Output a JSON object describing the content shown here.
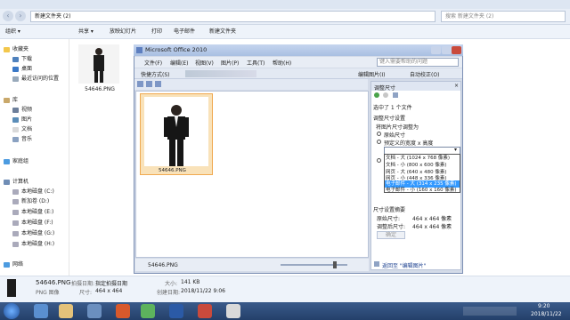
{
  "explorer": {
    "title": "新建文件夹 (2)",
    "address": "新建文件夹 (2)",
    "search_placeholder": "搜索 新建文件夹 (2)",
    "toolbar": [
      "组织 ▾",
      "共享 ▾",
      "放映幻灯片",
      "打印",
      "电子邮件",
      "新建文件夹"
    ],
    "nav": {
      "favorites_header": "收藏夹",
      "favorites": [
        "下载",
        "桌面",
        "最近访问的位置"
      ],
      "libraries_header": "库",
      "libraries": [
        "视频",
        "图片",
        "文档",
        "音乐"
      ],
      "homegroup": "家庭组",
      "computer_header": "计算机",
      "drives": [
        "本地磁盘 (C:)",
        "新加卷 (D:)",
        "本地磁盘 (E:)",
        "本地磁盘 (F:)",
        "本地磁盘 (G:)",
        "本地磁盘 (H:)"
      ],
      "network": "网络"
    },
    "file": {
      "name": "54646.PNG"
    },
    "details": {
      "filename": "54646.PNG",
      "type": "PNG 图像",
      "shot_date_label": "拍摄日期:",
      "shot_date_value": "指定拍摄日期",
      "size_label": "尺寸:",
      "size_value": "464 x 464",
      "filesize_label": "大小:",
      "filesize_value": "141 KB",
      "created_label": "创建日期:",
      "created_value": "2018/11/22 9:06"
    }
  },
  "office": {
    "title": "Microsoft Office 2010",
    "menu": [
      "文件(F)",
      "编辑(E)",
      "视图(V)",
      "图片(P)",
      "工具(T)",
      "帮助(H)"
    ],
    "help_placeholder": "键入需要帮助的问题",
    "toolbar_shortcut": "快捷方式(S)",
    "edit_picture": "编辑图片(I)",
    "auto_correct": "自动校正(O)",
    "thumb_caption": "54646.PNG",
    "status_name": "54646.PNG",
    "pane": {
      "title": "调整尺寸",
      "selected": "选中了 1 个文件",
      "section1": "调整尺寸设置",
      "resize_as": "将图片尺寸调整为",
      "opt_original": "原始尺寸",
      "opt_custom": "预定义的宽度 x 高度",
      "dropdown_options": [
        "文档 - 大 (1024 x 768 像素)",
        "文档 - 小 (800 x 600 像素)",
        "网页 - 大 (640 x 480 像素)",
        "网页 - 小 (448 x 336 像素)",
        "电子邮件 - 大 (314 x 235 像素)",
        "电子邮件 - 小 (160 x 160 像素)"
      ],
      "selected_option_index": 4,
      "summary_title": "尺寸设置摘要",
      "original_label": "原始尺寸:",
      "original_value": "464 x 464 像素",
      "adjusted_label": "调整后尺寸:",
      "adjusted_value": "464 x 464 像素",
      "ok": "确定",
      "back_link": "返回至 \"编辑图片\""
    }
  },
  "taskbar": {
    "time": "9:20",
    "date": "2018/11/22"
  },
  "colors": {
    "accent": "#3a5a8a",
    "highlight": "#3399ff",
    "thumb_bg": "#f9e2b9"
  }
}
